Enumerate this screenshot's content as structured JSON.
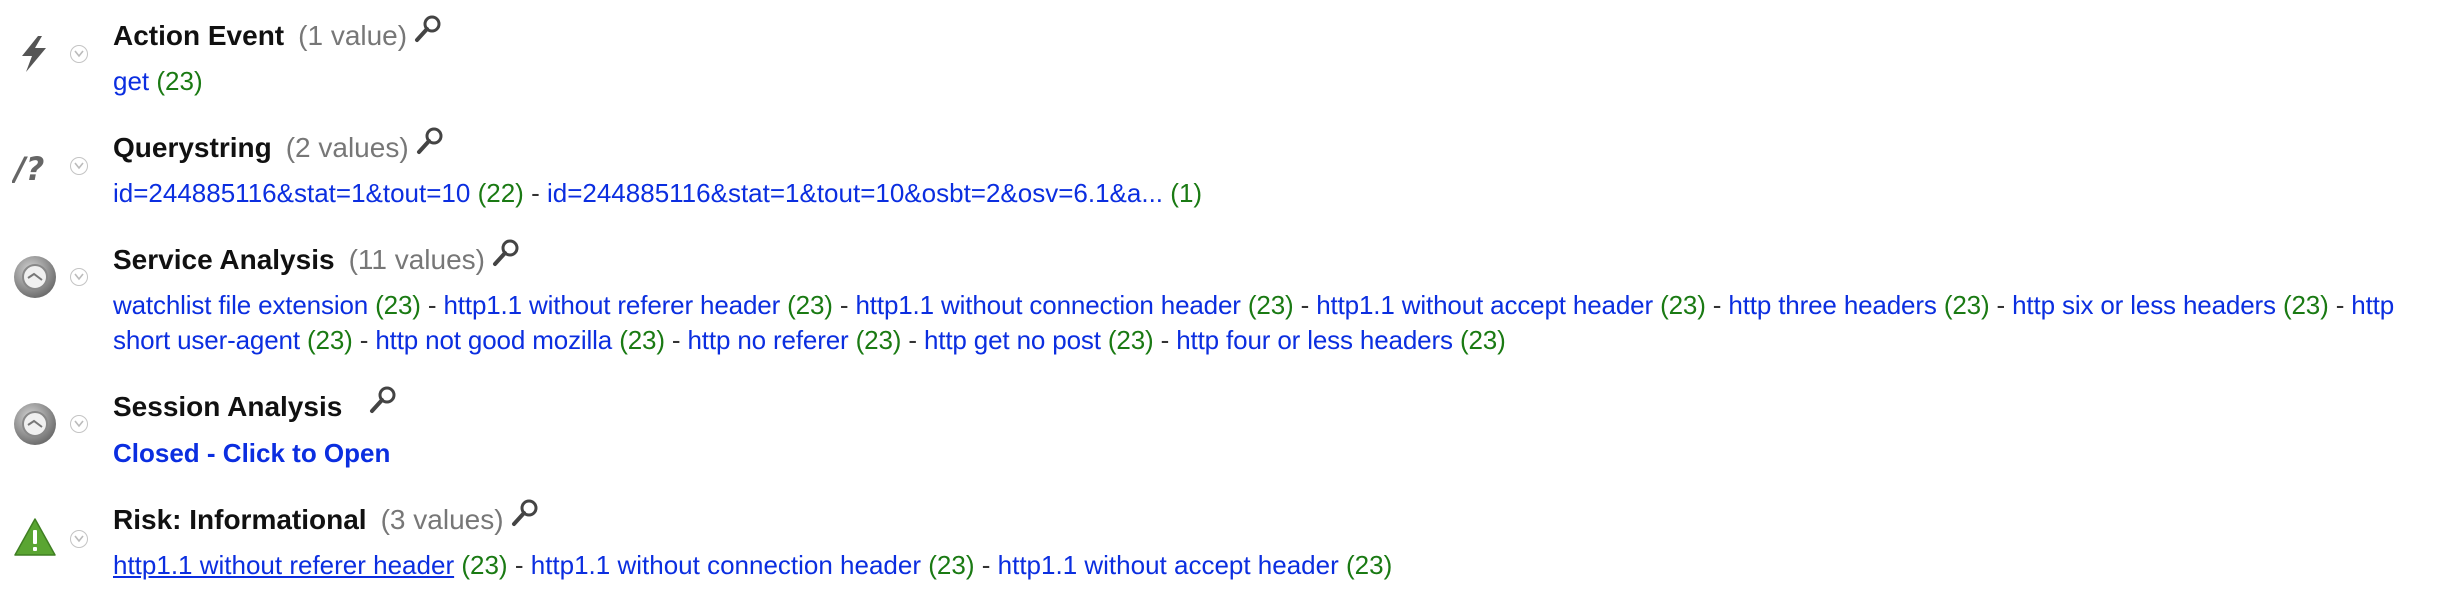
{
  "sections": [
    {
      "title": "Action Event",
      "count": "(1 value)",
      "icon": "lightning-icon",
      "values": [
        {
          "text": "get",
          "count": "(23)"
        }
      ]
    },
    {
      "title": "Querystring",
      "count": "(2 values)",
      "icon": "querystring-icon",
      "values": [
        {
          "text": "id=244885116&stat=1&tout=10",
          "count": "(22)"
        },
        {
          "text": "id=244885116&stat=1&tout=10&osbt=2&osv=6.1&a...",
          "count": "(1)"
        }
      ]
    },
    {
      "title": "Service Analysis",
      "count": "(11 values)",
      "icon": "service-analysis-icon",
      "values": [
        {
          "text": "watchlist file extension",
          "count": "(23)"
        },
        {
          "text": "http1.1 without referer header",
          "count": "(23)"
        },
        {
          "text": "http1.1 without connection header",
          "count": "(23)"
        },
        {
          "text": "http1.1 without accept header",
          "count": "(23)"
        },
        {
          "text": "http three headers",
          "count": "(23)"
        },
        {
          "text": "http six or less headers",
          "count": "(23)"
        },
        {
          "text": "http short user-agent",
          "count": "(23)"
        },
        {
          "text": "http not good mozilla",
          "count": "(23)"
        },
        {
          "text": "http no referer",
          "count": "(23)"
        },
        {
          "text": "http get no post",
          "count": "(23)"
        },
        {
          "text": "http four or less headers",
          "count": "(23)"
        }
      ]
    },
    {
      "title": "Session Analysis",
      "count": "",
      "icon": "session-analysis-icon",
      "closed_label": "Closed - Click to Open"
    },
    {
      "title": "Risk: Informational",
      "count": "(3 values)",
      "icon": "warning-icon",
      "values": [
        {
          "text": "http1.1 without referer header",
          "count": "(23)"
        },
        {
          "text": "http1.1 without connection header",
          "count": "(23)"
        },
        {
          "text": "http1.1 without accept header",
          "count": "(23)"
        }
      ]
    }
  ],
  "separator": "-",
  "colors": {
    "link": "#0b2ee0",
    "count": "#1a7a13",
    "header_count": "#777777",
    "warning": "#5aa532"
  }
}
